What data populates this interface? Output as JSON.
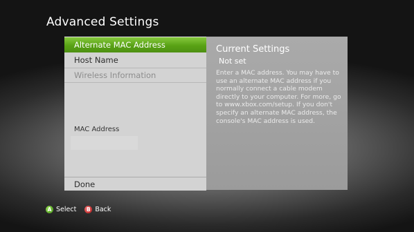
{
  "page": {
    "title": "Advanced Settings"
  },
  "menu": {
    "items": [
      {
        "label": "Alternate MAC Address",
        "state": "selected"
      },
      {
        "label": "Host Name",
        "state": "normal"
      },
      {
        "label": "Wireless Information",
        "state": "disabled"
      }
    ],
    "mac_address": {
      "label": "MAC Address",
      "value": ""
    },
    "done_label": "Done"
  },
  "info": {
    "heading": "Current Settings",
    "value": "Not set",
    "description": "Enter a MAC address. You may have to use an alternate MAC address if you normally connect a cable modem directly to your computer. For more, go to www.xbox.com/setup. If you don't specify an alternate MAC address, the console's MAC address is used."
  },
  "footer": {
    "select": {
      "button": "A",
      "label": "Select"
    },
    "back": {
      "button": "B",
      "label": "Back"
    }
  },
  "colors": {
    "selected": "#59a215",
    "button_a": "#3e8d12",
    "button_b": "#b31616"
  }
}
